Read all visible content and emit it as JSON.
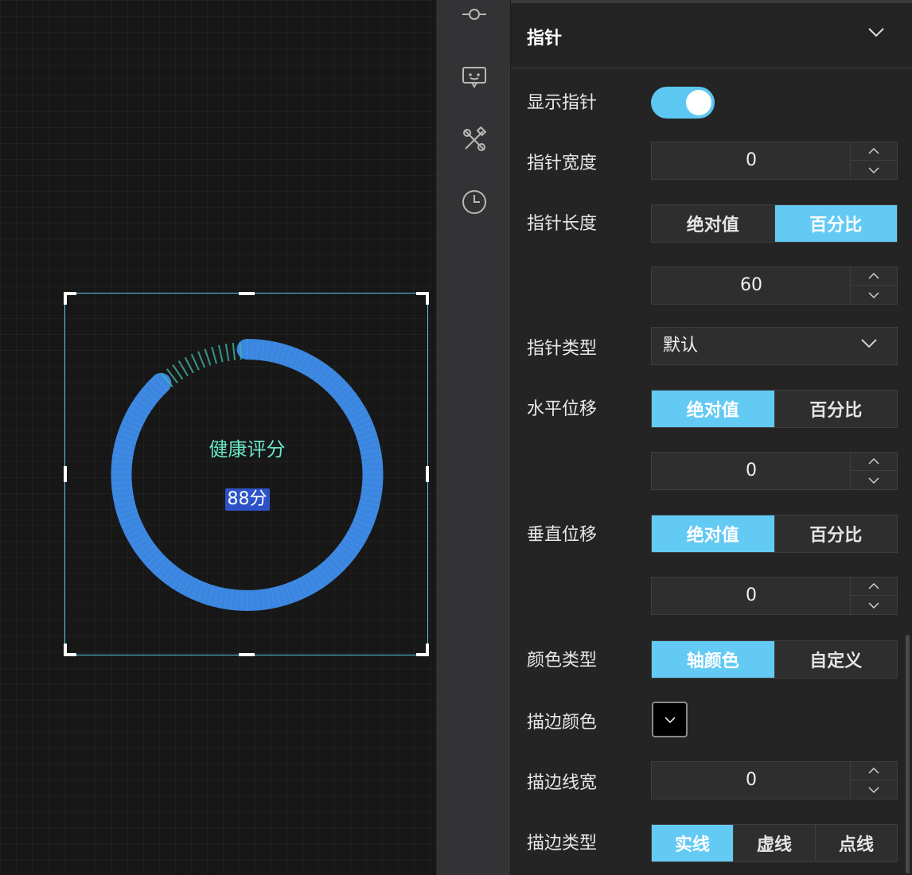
{
  "canvas": {
    "gauge": {
      "title": "健康评分",
      "value_label": "88分",
      "value": 88,
      "max": 100,
      "arc_color": "#3a86e0",
      "tick_color": "#3fb8a4",
      "title_color": "#67e6c6"
    }
  },
  "toolbar": {
    "icons": [
      "interaction-icon",
      "chat-icon",
      "tools-icon",
      "history-icon"
    ]
  },
  "panel": {
    "section_title": "指针",
    "show_pointer": {
      "label": "显示指针",
      "on": true
    },
    "pointer_width": {
      "label": "指针宽度",
      "value": "0"
    },
    "pointer_length": {
      "label": "指针长度",
      "options": [
        "绝对值",
        "百分比"
      ],
      "selected": "百分比",
      "value": "60"
    },
    "pointer_type": {
      "label": "指针类型",
      "value": "默认"
    },
    "h_offset": {
      "label": "水平位移",
      "options": [
        "绝对值",
        "百分比"
      ],
      "selected": "绝对值",
      "value": "0"
    },
    "v_offset": {
      "label": "垂直位移",
      "options": [
        "绝对值",
        "百分比"
      ],
      "selected": "绝对值",
      "value": "0"
    },
    "color_type": {
      "label": "颜色类型",
      "options": [
        "轴颜色",
        "自定义"
      ],
      "selected": "轴颜色"
    },
    "stroke_color": {
      "label": "描边颜色",
      "value": "#000000"
    },
    "stroke_width": {
      "label": "描边线宽",
      "value": "0"
    },
    "stroke_type": {
      "label": "描边类型",
      "options": [
        "实线",
        "虚线",
        "点线"
      ],
      "selected": "实线"
    }
  }
}
